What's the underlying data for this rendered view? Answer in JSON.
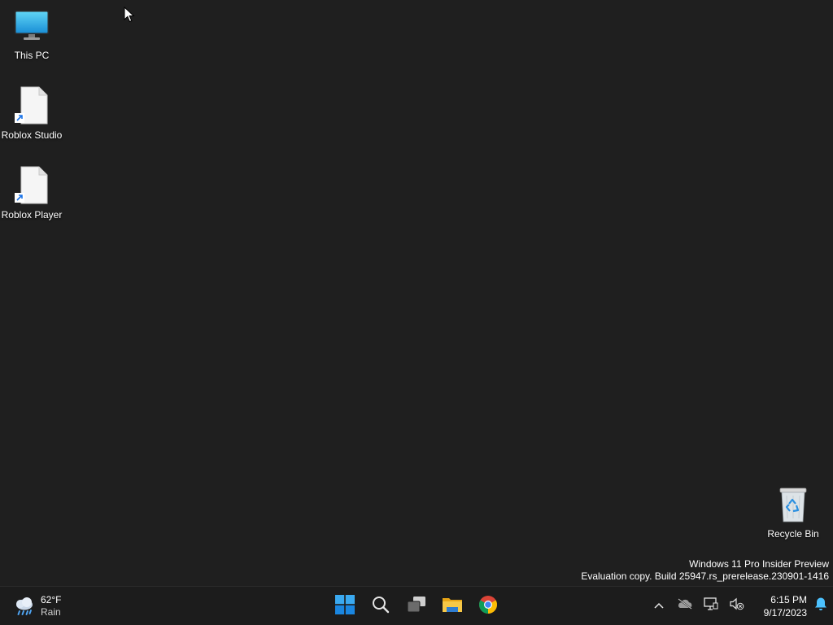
{
  "desktop": {
    "icons": [
      {
        "label": "This PC",
        "icon": "monitor-icon"
      },
      {
        "label": "Roblox Studio",
        "icon": "blank-file-shortcut-icon"
      },
      {
        "label": "Roblox Player",
        "icon": "blank-file-shortcut-icon"
      },
      {
        "label": "Recycle Bin",
        "icon": "recycle-bin-icon"
      }
    ],
    "watermark": {
      "line1": "Windows 11 Pro Insider Preview",
      "line2": "Evaluation copy. Build 25947.rs_prerelease.230901-1416"
    }
  },
  "taskbar": {
    "weather": {
      "temp": "62°F",
      "condition": "Rain",
      "icon": "rain-cloud-icon"
    },
    "pinned": [
      {
        "name": "start",
        "icon": "windows-logo-icon"
      },
      {
        "name": "search",
        "icon": "search-icon"
      },
      {
        "name": "task-view",
        "icon": "task-view-icon"
      },
      {
        "name": "file-explorer",
        "icon": "folder-icon"
      },
      {
        "name": "chrome",
        "icon": "chrome-icon"
      }
    ],
    "tray": {
      "icons": [
        "chevron-up-icon",
        "onedrive-offline-icon",
        "network-icon",
        "volume-muted-icon"
      ],
      "time": "6:15 PM",
      "date": "9/17/2023",
      "notification_icon": "bell-icon"
    }
  },
  "colors": {
    "desktop_bg": "#1f1f1f",
    "taskbar_bg": "#1c1c1c",
    "accent": "#4cc2ff"
  }
}
